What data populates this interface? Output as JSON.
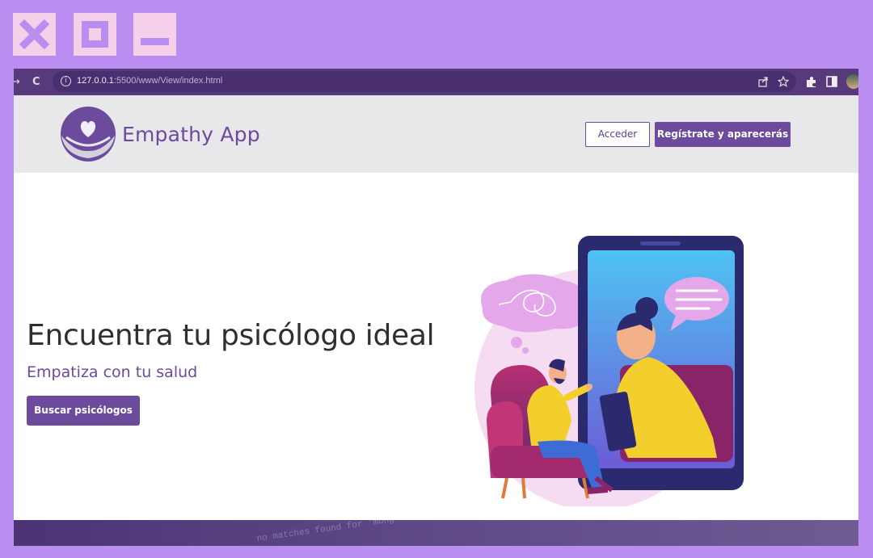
{
  "browser": {
    "url_host": "127.0.0.1",
    "url_rest": ":5500/www/View/index.html",
    "reload_glyph": "C",
    "back_glyph": "→"
  },
  "site": {
    "brand": "Empathy App",
    "login_label": "Acceder",
    "register_label": "Regístrate y aparecerás"
  },
  "hero": {
    "title": "Encuentra tu psicólogo ideal",
    "subtitle": "Empatiza con tu salud",
    "cta_label": "Buscar psicólogos"
  },
  "footer": {
    "ghost_text": "no  matches found for 'mong"
  },
  "colors": {
    "page_bg": "#b98ef0",
    "window_buttons": "#f6cfe8",
    "accent": "#6c4a9c",
    "header_bg": "#e8e8ea",
    "browser_bar": "#563a7c"
  },
  "icons": [
    "close-icon",
    "maximize-icon",
    "minimize-icon",
    "info-icon",
    "share-icon",
    "star-icon",
    "extensions-icon",
    "sidepanel-icon",
    "profile-avatar",
    "heart-logo-icon"
  ]
}
